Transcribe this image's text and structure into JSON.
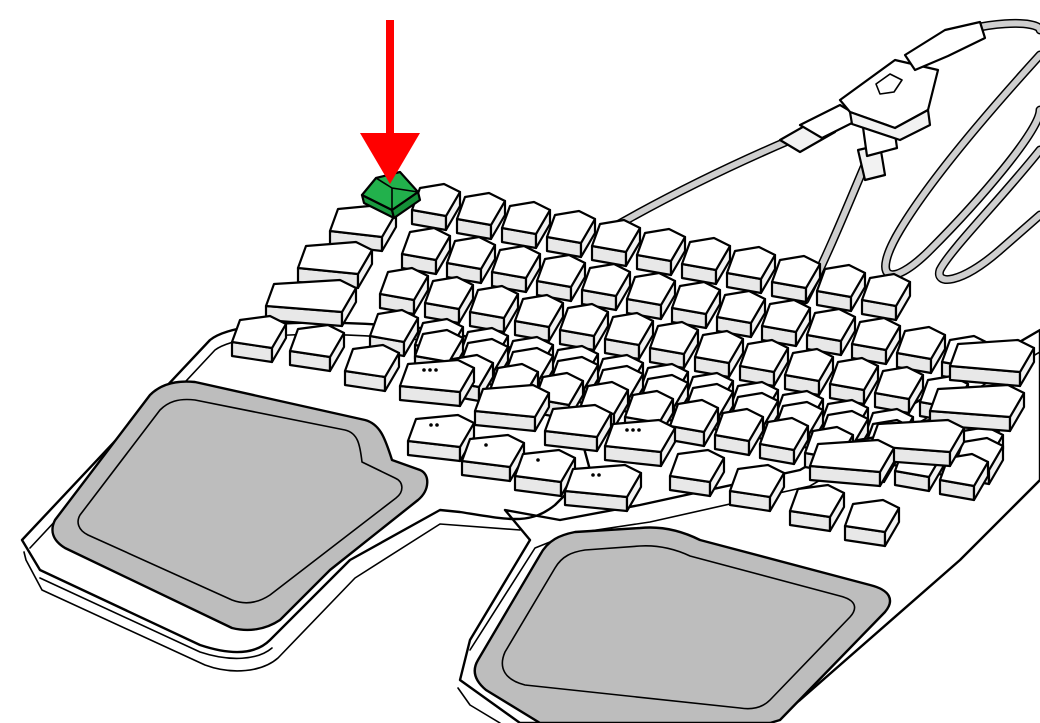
{
  "illustration": {
    "subject": "split-keyboard",
    "highlighted_key_color": "#22b14c",
    "arrow_color": "#ff0000",
    "palm_rest_color": "#bdbdbd",
    "body_color": "#ffffff",
    "outline_color": "#000000",
    "highlighted_key_label": ""
  }
}
